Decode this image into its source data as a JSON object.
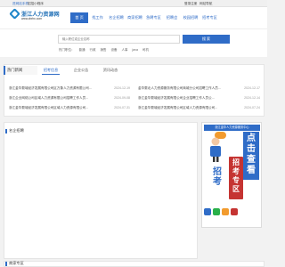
{
  "topbar": {
    "link_mobile": "进网站手机",
    "link_guide": "招招小程序",
    "login": "登录注册",
    "site_nav": "网站导航"
  },
  "header": {
    "logo_name": "浙江人力资源网",
    "logo_url": "www.zbrlrc.com",
    "nav": [
      "首 页",
      "找工作",
      "名企招聘",
      "商家招聘",
      "急聘专区",
      "招聘会",
      "校园招聘",
      "招考专区"
    ]
  },
  "search": {
    "placeholder": "输入职位或企业名称",
    "button": "搜 索",
    "hot_label": "热门职位：",
    "hot": [
      "普通",
      "行政",
      "销售",
      "设备",
      "人事",
      "java",
      "司机"
    ]
  },
  "news": {
    "left_title": "热门新闻",
    "tabs": [
      "招考信息",
      "企业公告",
      "资讯动态"
    ],
    "items": [
      {
        "title": "浙江金华婺城经济发展有限公司区万象人力资源有限公司...",
        "date": "2024-12-19"
      },
      {
        "title": "浙江企业网络公司区域人力资源有限公司招聘工作人员...",
        "date": "2024-09-08"
      },
      {
        "title": "浙江金华婺城经济发展有限公司区域人力资源有限公司...",
        "date": "2024-07-31"
      },
      {
        "title": "金华婺北人力资源服务有限公司商城分公司招聘工作人员...",
        "date": "2024-12-17"
      },
      {
        "title": "浙江金华婺城经济发展有限公司企业招聘工作人员公...",
        "date": "2024-12-14"
      },
      {
        "title": "浙江金华婺城经济发展有限公司区域人力资源有限公司...",
        "date": "2024-07-24"
      }
    ]
  },
  "sections": {
    "famous": "名企招聘",
    "business": "商家专区"
  },
  "ad": {
    "top_text": "浙江金华人力资源服务中心",
    "col1": [
      "点",
      "击",
      "查",
      "看"
    ],
    "col2": [
      "招",
      "考",
      "专",
      "区"
    ],
    "big": [
      "招",
      "考"
    ]
  },
  "colors": {
    "accent": "#2f6cc7",
    "red": "#c53432",
    "orange": "#f29b2e"
  }
}
